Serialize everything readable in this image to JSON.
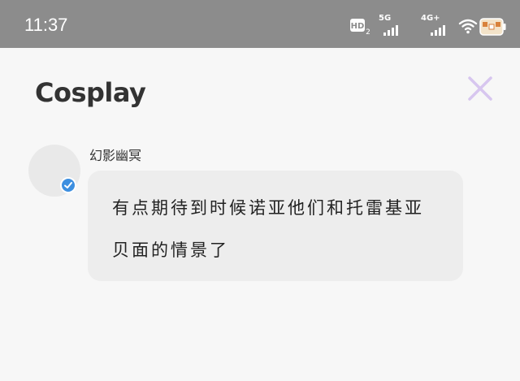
{
  "status_bar": {
    "time": "11:37",
    "hd_label": "HD",
    "hd_sub": "2",
    "sig1_label": "5G",
    "sig2_label": "4G+",
    "background": "#8c8c8c"
  },
  "header": {
    "title": "Cosplay",
    "close_icon": "close-icon",
    "close_color": "#d7c6ef"
  },
  "post": {
    "username": "幻影幽冥",
    "verified": true,
    "badge_color": "#3d8fe0",
    "message": "有点期待到时候诺亚他们和托雷基亚贝面的情景了"
  }
}
